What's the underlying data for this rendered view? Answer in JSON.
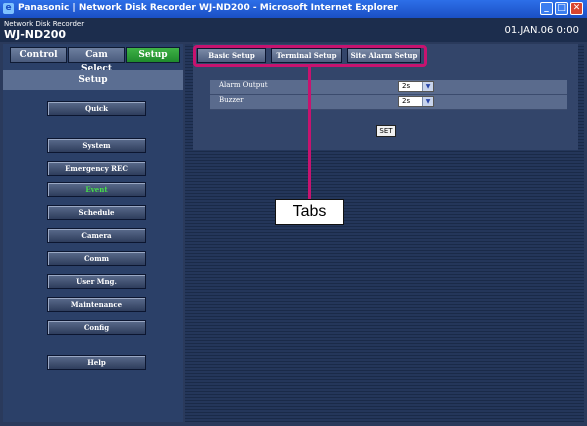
{
  "window": {
    "title": "Panasonic | Network Disk Recorder WJ-ND200 - Microsoft Internet Explorer",
    "min": "_",
    "max": "□",
    "close": "✕"
  },
  "header": {
    "subtitle": "Network Disk Recorder",
    "model": "WJ-ND200",
    "datetime": "01.JAN.06  0:00"
  },
  "top_buttons": [
    {
      "label": "Control"
    },
    {
      "label": "Cam Select"
    },
    {
      "label": "Setup"
    }
  ],
  "setup_title": "Setup",
  "menu": [
    {
      "label": "Quick"
    },
    {
      "label": "System"
    },
    {
      "label": "Emergency REC"
    },
    {
      "label": "Event"
    },
    {
      "label": "Schedule"
    },
    {
      "label": "Camera"
    },
    {
      "label": "Comm"
    },
    {
      "label": "User Mng."
    },
    {
      "label": "Maintenance"
    },
    {
      "label": "Config"
    },
    {
      "label": "Help"
    }
  ],
  "active_menu": "Event",
  "tabs": [
    {
      "label": "Basic Setup"
    },
    {
      "label": "Terminal Setup"
    },
    {
      "label": "Site Alarm Setup"
    }
  ],
  "settings": [
    {
      "label": "Alarm Output",
      "value": "2s"
    },
    {
      "label": "Buzzer",
      "value": "2s"
    }
  ],
  "set_button": "SET",
  "callout": "Tabs",
  "colors": {
    "highlight": "#c7136f",
    "active_green": "#46e04a",
    "setup_button": "#1f8a2c"
  }
}
